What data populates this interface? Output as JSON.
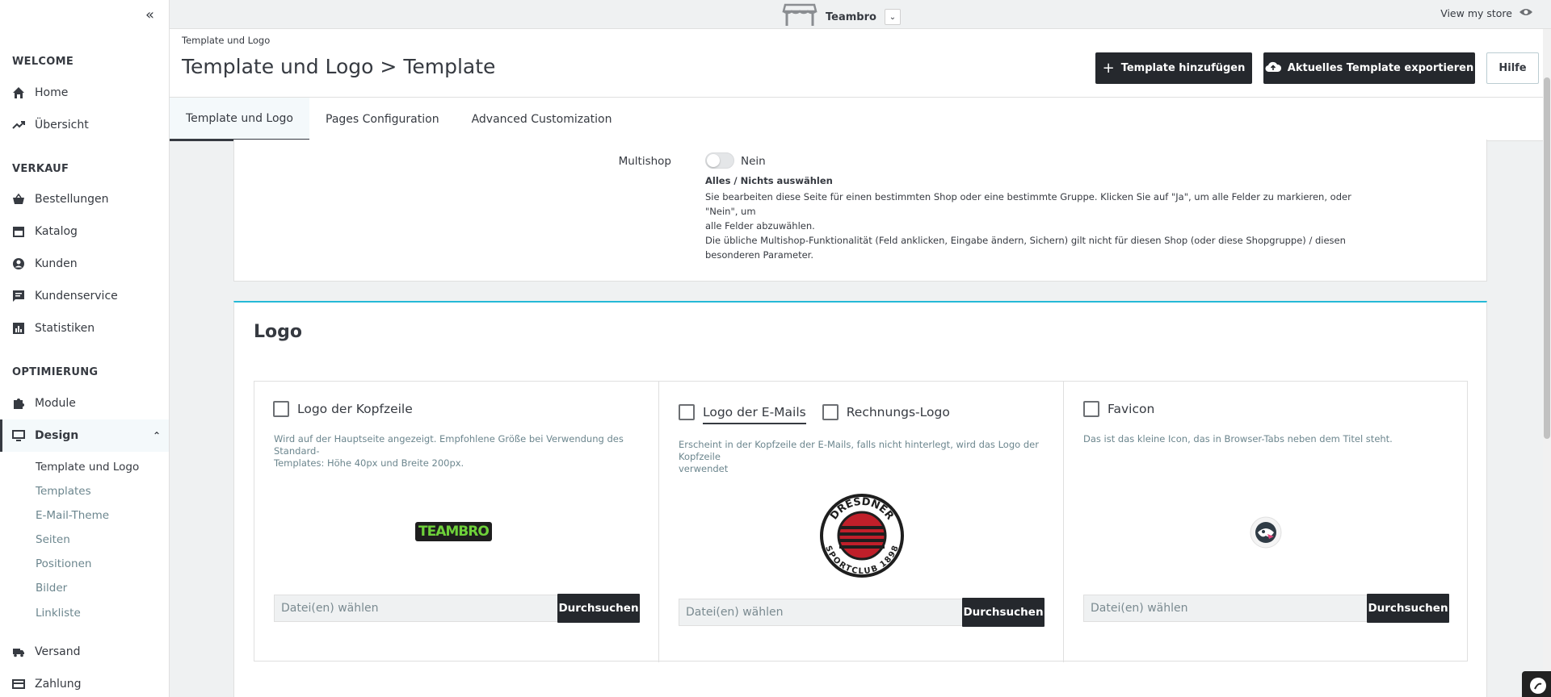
{
  "sidebar": {
    "collapse_icon": "«",
    "sections": [
      {
        "title": "WELCOME"
      },
      {
        "title": "VERKAUF"
      },
      {
        "title": "OPTIMIERUNG"
      }
    ],
    "items": [
      {
        "label": "Home",
        "icon": "home-icon"
      },
      {
        "label": "Übersicht",
        "icon": "trending-icon"
      },
      {
        "label": "Bestellungen",
        "icon": "basket-icon"
      },
      {
        "label": "Katalog",
        "icon": "store-icon"
      },
      {
        "label": "Kunden",
        "icon": "user-icon"
      },
      {
        "label": "Kundenservice",
        "icon": "chat-icon"
      },
      {
        "label": "Statistiken",
        "icon": "chart-icon"
      },
      {
        "label": "Module",
        "icon": "puzzle-icon"
      },
      {
        "label": "Design",
        "icon": "monitor-icon"
      },
      {
        "label": "Versand",
        "icon": "truck-icon"
      },
      {
        "label": "Zahlung",
        "icon": "card-icon"
      }
    ],
    "design_subitems": [
      {
        "label": "Template und Logo"
      },
      {
        "label": "Templates"
      },
      {
        "label": "E-Mail-Theme"
      },
      {
        "label": "Seiten"
      },
      {
        "label": "Positionen"
      },
      {
        "label": "Bilder"
      },
      {
        "label": "Linkliste"
      }
    ]
  },
  "topbar": {
    "shop_name": "Teambro",
    "view_store": "View my store"
  },
  "header": {
    "breadcrumb": "Template und Logo",
    "title": "Template und Logo > Template",
    "add_template": "Template hinzufügen",
    "export_template": "Aktuelles Template exportieren",
    "help": "Hilfe"
  },
  "tabs": [
    {
      "label": "Template und Logo"
    },
    {
      "label": "Pages Configuration"
    },
    {
      "label": "Advanced Customization"
    }
  ],
  "multishop": {
    "label": "Multishop",
    "toggle_value": "Nein",
    "heading": "Alles / Nichts auswählen",
    "line1": "Sie bearbeiten diese Seite für einen bestimmten Shop oder eine bestimmte Gruppe. Klicken Sie auf \"Ja\", um alle Felder zu markieren, oder \"Nein\", um",
    "line2": "alle Felder abzuwählen.",
    "line3": "Die übliche Multishop-Funktionalität (Feld anklicken, Eingabe ändern, Sichern) gilt nicht für diesen Shop (oder diese Shopgruppe) / diesen",
    "line4": "besonderen Parameter."
  },
  "logo": {
    "title": "Logo",
    "header_logo": {
      "label": "Logo der Kopfzeile",
      "desc1": "Wird auf der Hauptseite angezeigt. Empfohlene Größe bei Verwendung des Standard-",
      "desc2": "Templates: Höhe 40px und Breite 200px.",
      "image_text": "TEAMBRO",
      "file_placeholder": "Datei(en) wählen",
      "browse": "Durchsuchen"
    },
    "email_logo": {
      "label": "Logo der E-Mails",
      "invoice_label": "Rechnungs-Logo",
      "desc1": "Erscheint in der Kopfzeile der E-Mails, falls nicht hinterlegt, wird das Logo der Kopfzeile",
      "desc2": "verwendet",
      "badge_top": "DRESDNER",
      "badge_bottom": "SPORTCLUB 1898",
      "file_placeholder": "Datei(en) wählen",
      "browse": "Durchsuchen"
    },
    "favicon": {
      "label": "Favicon",
      "desc1": "Das ist das kleine Icon, das in Browser-Tabs neben dem Titel steht.",
      "file_placeholder": "Datei(en) wählen",
      "browse": "Durchsuchen"
    }
  }
}
